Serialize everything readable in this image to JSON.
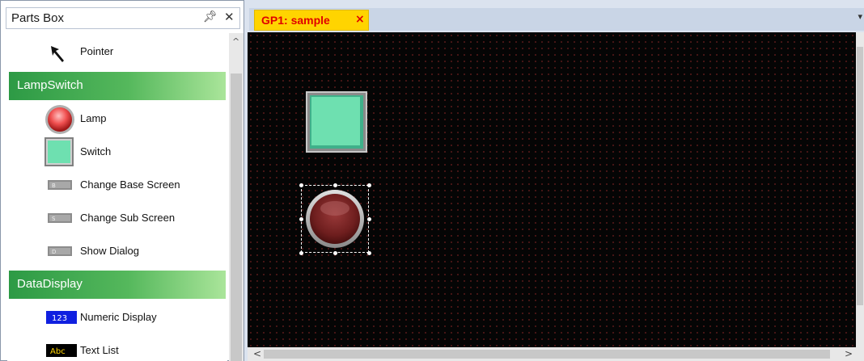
{
  "parts_box": {
    "title": "Parts Box",
    "pin_icon": "pin-icon",
    "close_icon": "close-icon",
    "items": [
      {
        "label": "Pointer",
        "icon": "pointer-arrow-icon"
      },
      {
        "category": "LampSwitch"
      },
      {
        "label": "Lamp",
        "icon": "lamp-icon"
      },
      {
        "label": "Switch",
        "icon": "switch-icon"
      },
      {
        "label": "Change Base Screen",
        "icon": "change-base-screen-icon",
        "badge": "B"
      },
      {
        "label": "Change Sub Screen",
        "icon": "change-sub-screen-icon",
        "badge": "S"
      },
      {
        "label": "Show Dialog",
        "icon": "show-dialog-icon",
        "badge": "D"
      },
      {
        "category": "DataDisplay"
      },
      {
        "label": "Numeric Display",
        "icon": "numeric-display-icon",
        "badge": "123"
      },
      {
        "label": "Text List",
        "icon": "text-list-icon",
        "badge": "Abc"
      }
    ]
  },
  "editor": {
    "tab_label": "GP1: sample",
    "tab_close": "×"
  },
  "colors": {
    "category_green": "#2d9a45",
    "tab_yellow": "#ffd400",
    "tab_text_red": "#e00000",
    "switch_green": "#6ee0b0",
    "lamp_red": "#7a2020"
  }
}
